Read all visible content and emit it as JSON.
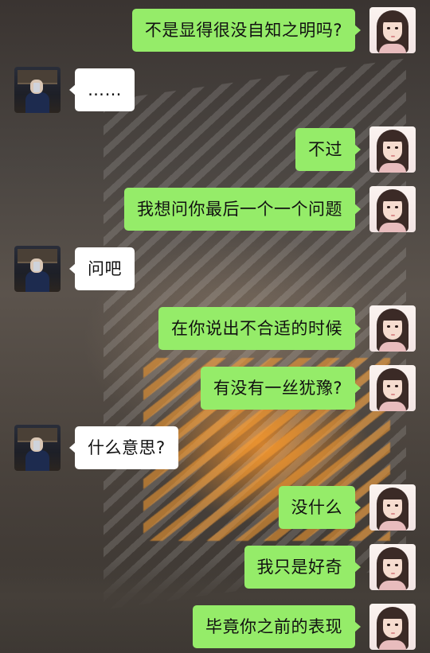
{
  "conversation": {
    "messages": [
      {
        "side": "right",
        "sender": "me",
        "text": "不是显得很没自知之明吗?"
      },
      {
        "side": "left",
        "sender": "contact",
        "text": "……"
      },
      {
        "side": "right",
        "sender": "me",
        "text": "不过"
      },
      {
        "side": "right",
        "sender": "me",
        "text": "我想问你最后一个一个问题"
      },
      {
        "side": "left",
        "sender": "contact",
        "text": "问吧"
      },
      {
        "side": "right",
        "sender": "me",
        "text": "在你说出不合适的时候"
      },
      {
        "side": "right",
        "sender": "me",
        "text": "有没有一丝犹豫?"
      },
      {
        "side": "left",
        "sender": "contact",
        "text": "什么意思?"
      },
      {
        "side": "right",
        "sender": "me",
        "text": "没什么"
      },
      {
        "side": "right",
        "sender": "me",
        "text": "我只是好奇"
      },
      {
        "side": "right",
        "sender": "me",
        "text": "毕竟你之前的表现"
      }
    ]
  },
  "colors": {
    "outgoing_bubble": "#95ec69",
    "incoming_bubble": "#ffffff",
    "text": "#111111"
  },
  "icons": {
    "me_avatar": "girl-avatar-icon",
    "contact_avatar": "boy-avatar-icon"
  }
}
